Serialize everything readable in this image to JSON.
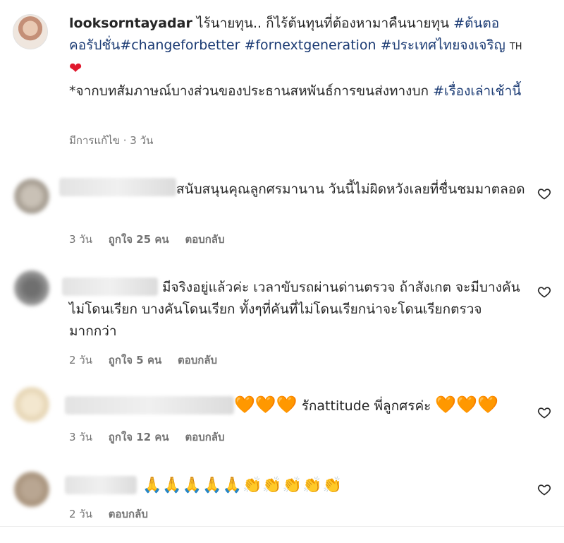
{
  "post": {
    "username": "looksorntayadar",
    "caption_part1": " ไร้นายทุน.. ก็ไร้ต้นทุนที่ต้องหามาคืนนายทุน ",
    "tag1": "#ต้นตอคอรัปชั่น",
    "tag2": "#changeforbetter",
    "tag3": "#fornextgeneration",
    "tag4": "#ประเทศไทยจงเจริญ",
    "flag_label": "TH",
    "heart": "❤",
    "caption_part2": "*จากบทสัมภาษณ์บางส่วนของประธานสหพันธ์การขนส่งทางบก ",
    "tag5": "#เรื่องเล่าเช้านี้",
    "meta": "มีการแก้ไข · 3 วัน"
  },
  "comments": [
    {
      "text": "สนับสนุนคุณลูกศรมานาน วันนี้ไม่ผิดหวังเลยที่ชื่นชมมาตลอด",
      "time": "3 วัน",
      "likes": "ถูกใจ 25 คน",
      "reply": "ตอบกลับ"
    },
    {
      "text": "มีจริงอยู่แล้วค่ะ เวลาขับรถผ่านด่านตรวจ ถ้าสังเกต จะมีบางคันไม่โดนเรียก บางคันโดนเรียก ทั้งๆที่คันที่ไม่โดนเรียกน่าจะโดนเรียกตรวจมากกว่า",
      "time": "2 วัน",
      "likes": "ถูกใจ 5 คน",
      "reply": "ตอบกลับ"
    },
    {
      "hearts_left": "🧡🧡🧡",
      "text": " รักattitude พี่ลูกศรค่ะ ",
      "hearts_right": "🧡🧡🧡",
      "time": "3 วัน",
      "likes": "ถูกใจ 12 คน",
      "reply": "ตอบกลับ"
    },
    {
      "emojis": "🙏🙏🙏🙏🙏👏👏👏👏👏",
      "time": "2 วัน",
      "reply": "ตอบกลับ"
    }
  ],
  "icons": {
    "like": "heart-outline-icon"
  }
}
